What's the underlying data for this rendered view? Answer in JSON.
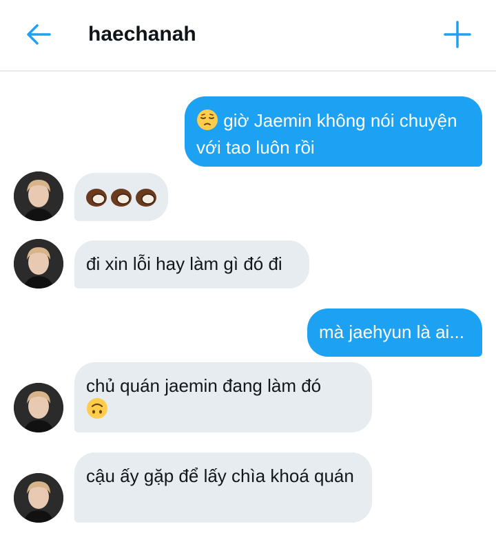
{
  "header": {
    "title": "haechanah",
    "back_icon": "back-arrow-icon",
    "add_icon": "plus-icon",
    "accent_color": "#1da1f2"
  },
  "messages": [
    {
      "direction": "sent",
      "emoji": "pensive-face",
      "text": "giờ Jaemin không nói chuyện với tao luôn rồi"
    },
    {
      "direction": "received",
      "emoji": "coconut x3",
      "text": ""
    },
    {
      "direction": "received",
      "text": "đi xin lỗi hay làm gì đó đi"
    },
    {
      "direction": "sent",
      "text": "mà jaehyun là ai..."
    },
    {
      "direction": "received",
      "text": "chủ quán jaemin đang làm đó",
      "emoji": "upside-down-face"
    },
    {
      "direction": "received",
      "text": "cậu ấy gặp để lấy chìa khoá quán"
    }
  ],
  "colors": {
    "sent_bubble": "#1da1f2",
    "received_bubble": "#e6ecf0"
  }
}
